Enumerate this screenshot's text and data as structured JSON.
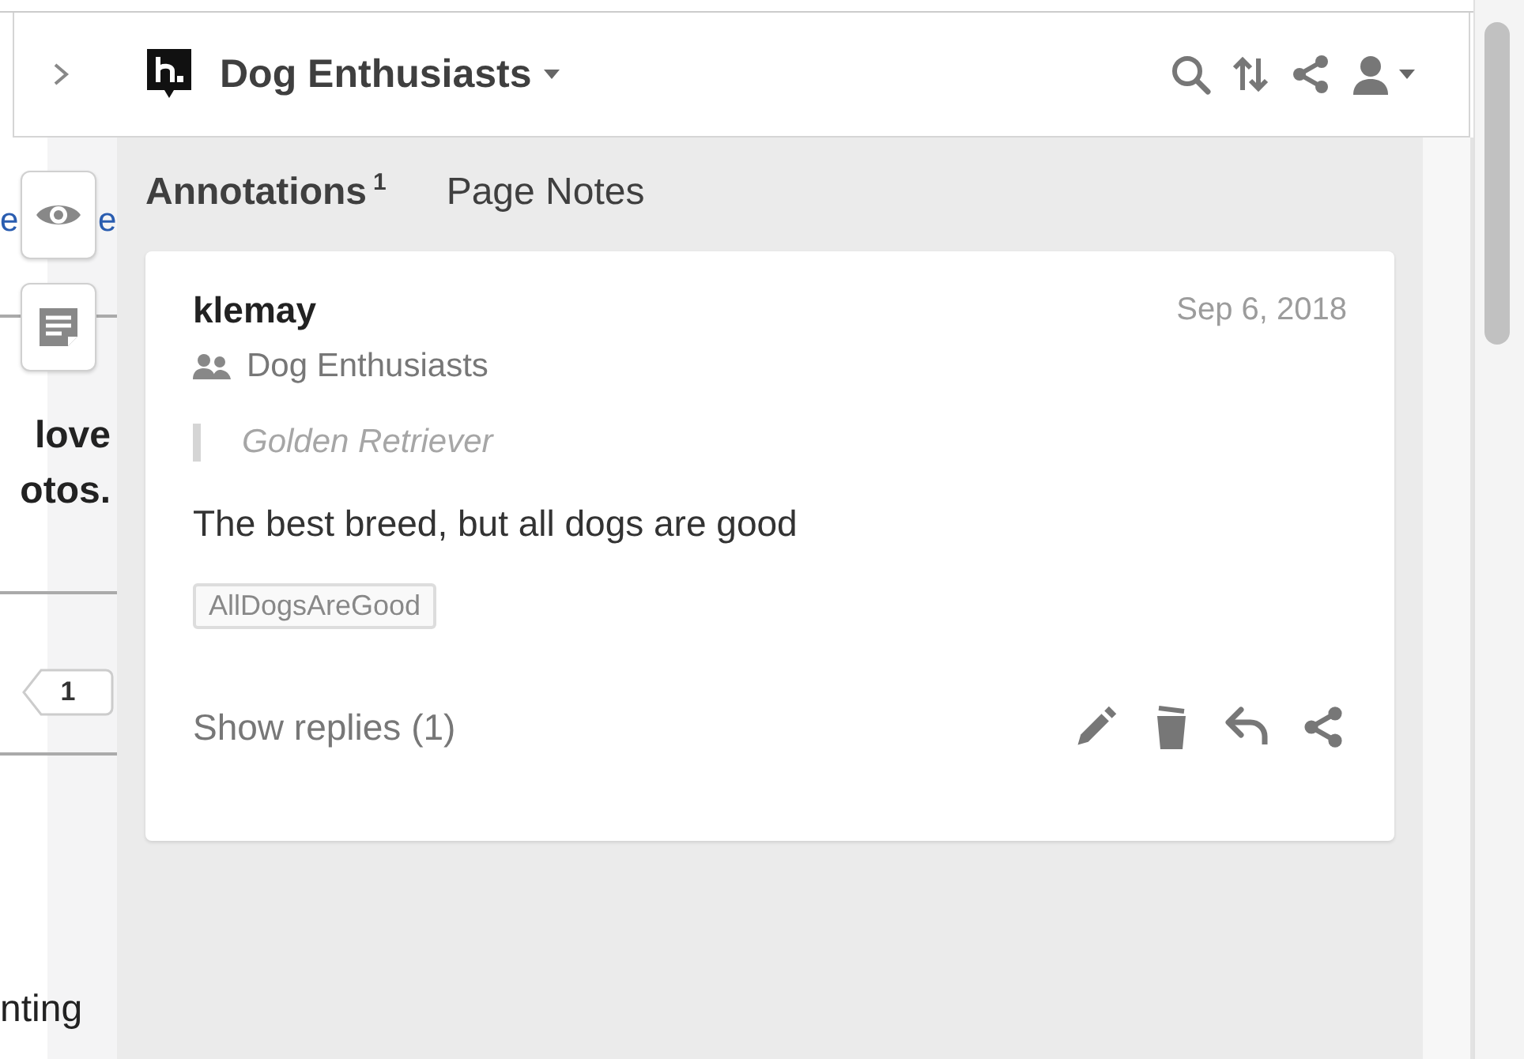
{
  "page": {
    "fragments": [
      {
        "text": "e",
        "kind": "link"
      },
      {
        "text": "e",
        "kind": "link"
      },
      {
        "text": "love",
        "kind": "heading"
      },
      {
        "text": "otos.",
        "kind": "heading"
      },
      {
        "text": "nting",
        "kind": "body"
      }
    ],
    "badge": "1"
  },
  "header": {
    "group_name": "Dog Enthusiasts"
  },
  "tabs": [
    {
      "label": "Annotations",
      "count": "1",
      "selected": true
    },
    {
      "label": "Page Notes",
      "selected": false
    }
  ],
  "annotation": {
    "user": "klemay",
    "date": "Sep 6, 2018",
    "group": "Dog Enthusiasts",
    "quote": "Golden Retriever",
    "text": "The best breed, but all dogs are good",
    "tags": [
      "AllDogsAreGood"
    ],
    "replies": "Show replies (1)"
  }
}
